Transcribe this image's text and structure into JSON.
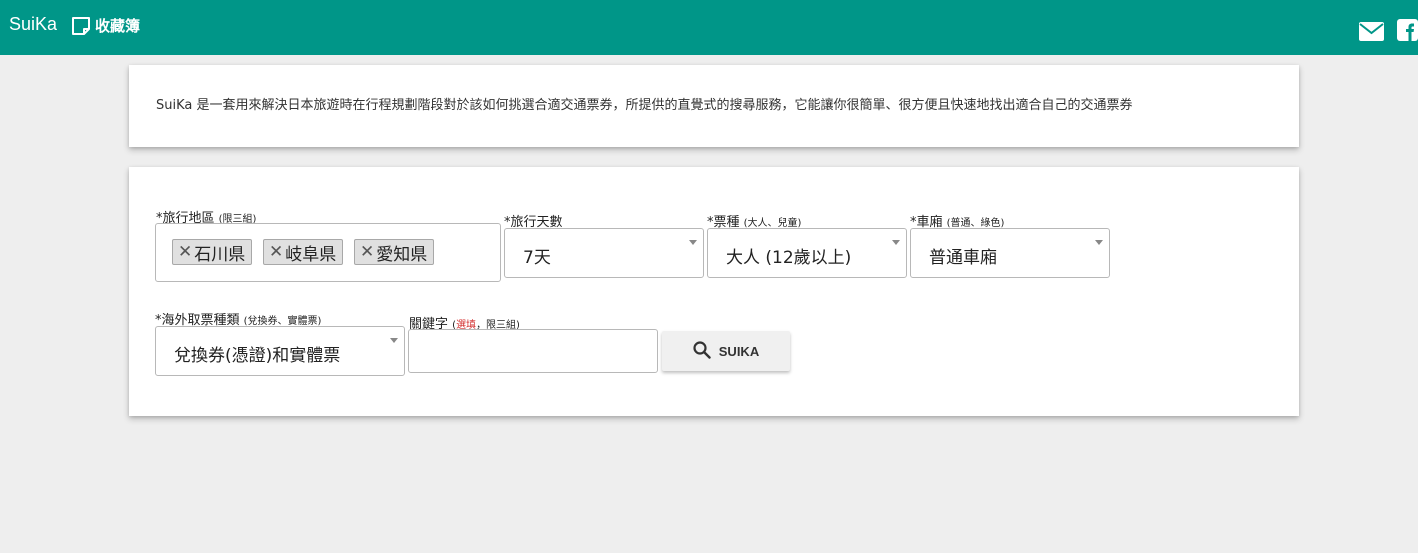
{
  "header": {
    "brand": "SuiKa",
    "favorites_label": "收藏簿",
    "icons": [
      "note-icon",
      "mail-icon",
      "facebook-icon"
    ],
    "accent_color": "#009688"
  },
  "intro": {
    "text": "SuiKa 是一套用來解決日本旅遊時在行程規劃階段對於該如何挑選合適交通票券，所提供的直覺式的搜尋服務，它能讓你很簡單、很方便且快速地找出適合自己的交通票券"
  },
  "form": {
    "region": {
      "label": "*旅行地區",
      "hint": "(限三組)",
      "chips": [
        "石川県",
        "岐阜県",
        "愛知県"
      ]
    },
    "days": {
      "label": "*旅行天數",
      "value": "7天"
    },
    "ticket_type": {
      "label": "*票種",
      "hint": "(大人、兒童)",
      "value": "大人 (12歲以上)"
    },
    "car": {
      "label": "*車廂",
      "hint": "(普通、綠色)",
      "value": "普通車廂"
    },
    "pickup": {
      "label": "*海外取票種類",
      "hint": "(兌換券、實體票)",
      "value": "兌換券(憑證)和實體票"
    },
    "keyword": {
      "label": "關鍵字",
      "hint_open": "(",
      "optional": "選填",
      "hint_rest": "，限三組)",
      "value": ""
    },
    "search_button": "SUIKA"
  }
}
